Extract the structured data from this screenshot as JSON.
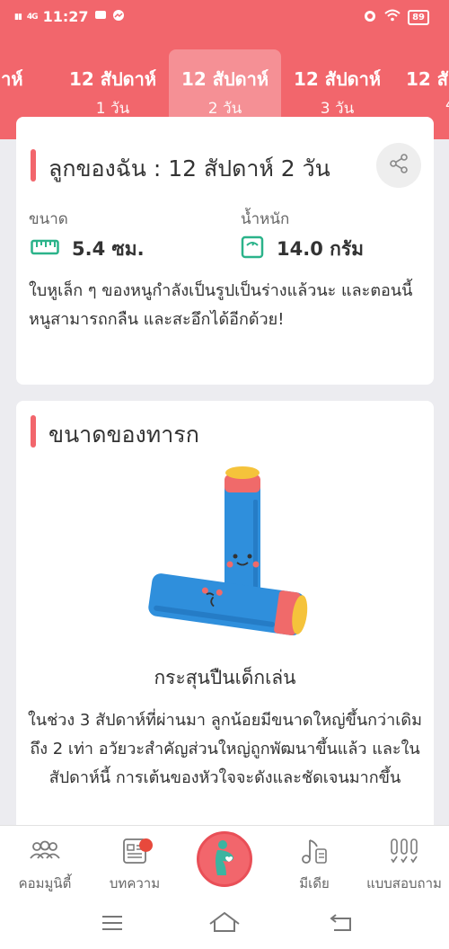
{
  "status_bar": {
    "time": "11:27",
    "battery": "89",
    "signal_text": "4G"
  },
  "week_tabs": [
    {
      "line1": "ปดาห์",
      "line2": ""
    },
    {
      "line1": "12 สัปดาห์",
      "line2": "1 วัน"
    },
    {
      "line1": "12 สัปดาห์",
      "line2": "2 วัน"
    },
    {
      "line1": "12 สัปดาห์",
      "line2": "3 วัน"
    },
    {
      "line1": "12 สั",
      "line2": "4"
    }
  ],
  "summary_card": {
    "title": "ลูกของฉัน : 12 สัปดาห์ 2  วัน",
    "size_label": "ขนาด",
    "size_value": "5.4 ซม.",
    "weight_label": "น้ำหนัก",
    "weight_value": "14.0 กรัม",
    "description": "ใบหูเล็ก ๆ ของหนูกำลังเป็นรูปเป็นร่างแล้วนะ และตอนนี้หนูสามารถกลืน และสะอึกได้อีกด้วย!"
  },
  "size_card": {
    "title": "ขนาดของทารก",
    "item_name": "กระสุนปืนเด็กเล่น",
    "description": "ในช่วง 3 สัปดาห์ที่ผ่านมา ลูกน้อยมีขนาดใหญ่ขึ้นกว่าเดิมถึง 2 เท่า อวัยวะสำคัญส่วนใหญ่ถูกพัฒนาขึ้นแล้ว และในสัปดาห์นี้ การเต้นของหัวใจจะดังและชัดเจนมากขึ้น"
  },
  "bottom_nav": {
    "community": "คอมมูนิตี้",
    "articles": "บทความ",
    "media": "มีเดีย",
    "quiz": "แบบสอบถาม"
  },
  "colors": {
    "accent": "#f2666c",
    "toy_blue": "#2f8fdc",
    "toy_pink": "#f06a6a",
    "toy_yellow": "#f5c33b"
  }
}
